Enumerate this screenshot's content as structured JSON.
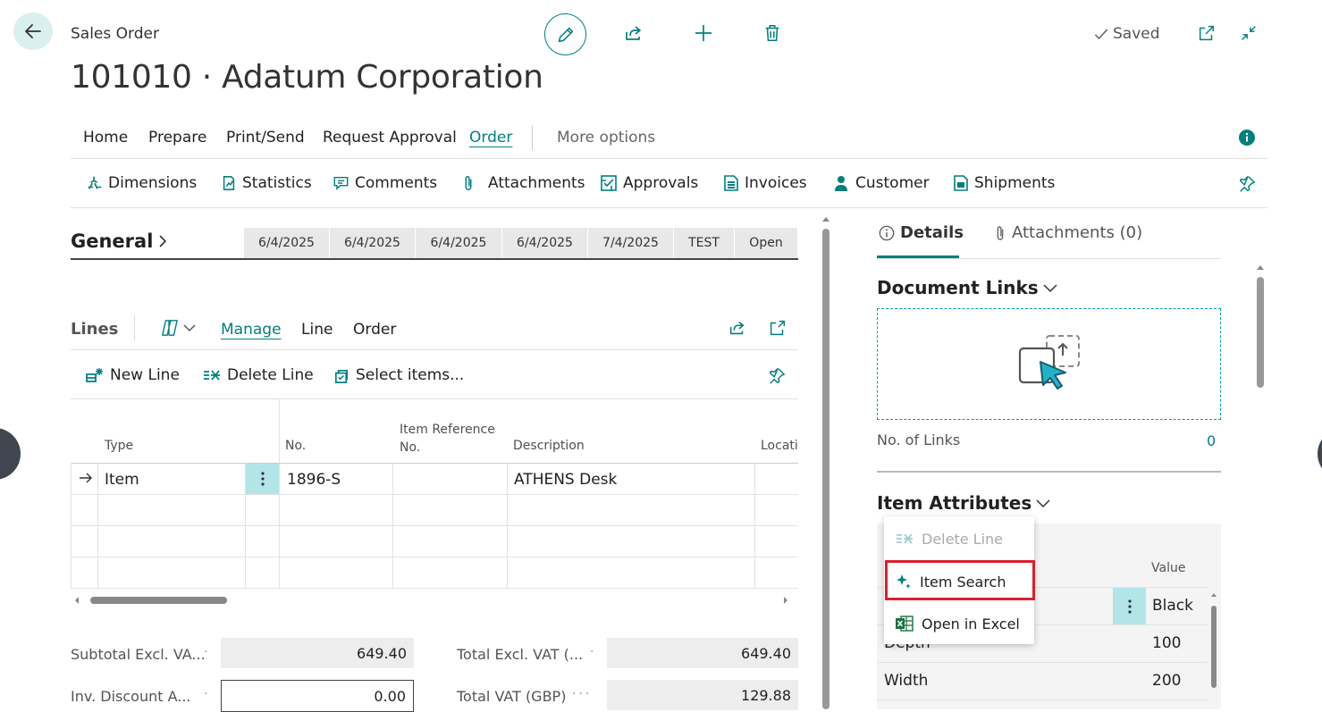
{
  "header": {
    "page_kind": "Sales Order",
    "page_title": "101010 · Adatum Corporation",
    "saved_label": "Saved"
  },
  "actionbar": {
    "items": [
      "Home",
      "Prepare",
      "Print/Send",
      "Request Approval",
      "Order"
    ],
    "more_options": "More options"
  },
  "subbar": {
    "items": [
      "Dimensions",
      "Statistics",
      "Comments",
      "Attachments",
      "Approvals",
      "Invoices",
      "Customer",
      "Shipments"
    ]
  },
  "general": {
    "title": "General",
    "summary": [
      "6/4/2025",
      "6/4/2025",
      "6/4/2025",
      "6/4/2025",
      "7/4/2025",
      "TEST",
      "Open"
    ]
  },
  "lines": {
    "title": "Lines",
    "menu": [
      "Manage",
      "Line",
      "Order"
    ],
    "actions": [
      "New Line",
      "Delete Line",
      "Select items..."
    ],
    "columns": {
      "type": "Type",
      "no": "No.",
      "item_ref_1": "Item Reference",
      "item_ref_2": "No.",
      "description": "Description",
      "location": "Locati"
    },
    "rows": [
      {
        "type": "Item",
        "no": "1896-S",
        "description": "ATHENS Desk"
      }
    ]
  },
  "totals": {
    "subtotal_label": "Subtotal Excl. VA...",
    "subtotal_value": "649.40",
    "inv_discount_label": "Inv. Discount A...",
    "inv_discount_value": "0.00",
    "total_excl_label": "Total Excl. VAT (...",
    "total_excl_value": "649.40",
    "total_vat_label": "Total VAT (GBP)",
    "total_vat_value": "129.88"
  },
  "factbox": {
    "tab_details": "Details",
    "tab_attachments": "Attachments (0)",
    "doc_links_title": "Document Links",
    "no_of_links_label": "No. of Links",
    "no_of_links_value": "0",
    "item_attributes_title": "Item Attributes",
    "value_header": "Value",
    "attributes": [
      {
        "name": "",
        "value": "Black"
      },
      {
        "name": "Depth",
        "value": "100"
      },
      {
        "name": "Width",
        "value": "200"
      }
    ]
  },
  "context_menu": {
    "items": [
      "Delete Line",
      "Item Search",
      "Open in Excel"
    ]
  },
  "colors": {
    "accent": "#00807d",
    "highlight_border": "#d9202c"
  }
}
